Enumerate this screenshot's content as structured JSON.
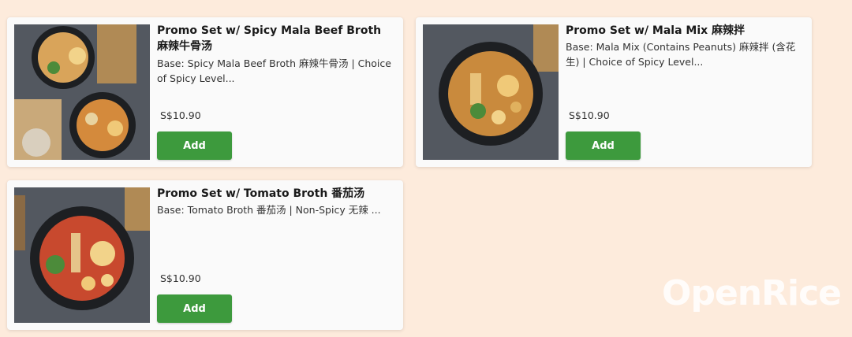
{
  "items": [
    {
      "title": "Promo Set w/ Spicy Mala Beef Broth 麻辣牛骨汤",
      "desc": "Base: Spicy Mala Beef Broth 麻辣牛骨汤 | Choice of Spicy Level...",
      "price": "S$10.90",
      "add_label": "Add"
    },
    {
      "title": "Promo Set w/ Mala Mix 麻辣拌",
      "desc": "Base: Mala Mix (Contains Peanuts) 麻辣拌 (含花生) |  Choice of Spicy Level...",
      "price": "S$10.90",
      "add_label": "Add"
    },
    {
      "title": "Promo Set w/ Tomato Broth 番茄汤",
      "desc": "Base: Tomato Broth 番茄汤 | Non-Spicy 无辣 ...",
      "price": "S$10.90",
      "add_label": "Add"
    }
  ],
  "watermark": "OpenRice",
  "colors": {
    "page_bg": "#fdebdc",
    "card_bg": "#fafafa",
    "add_button": "#3d9a3d"
  }
}
